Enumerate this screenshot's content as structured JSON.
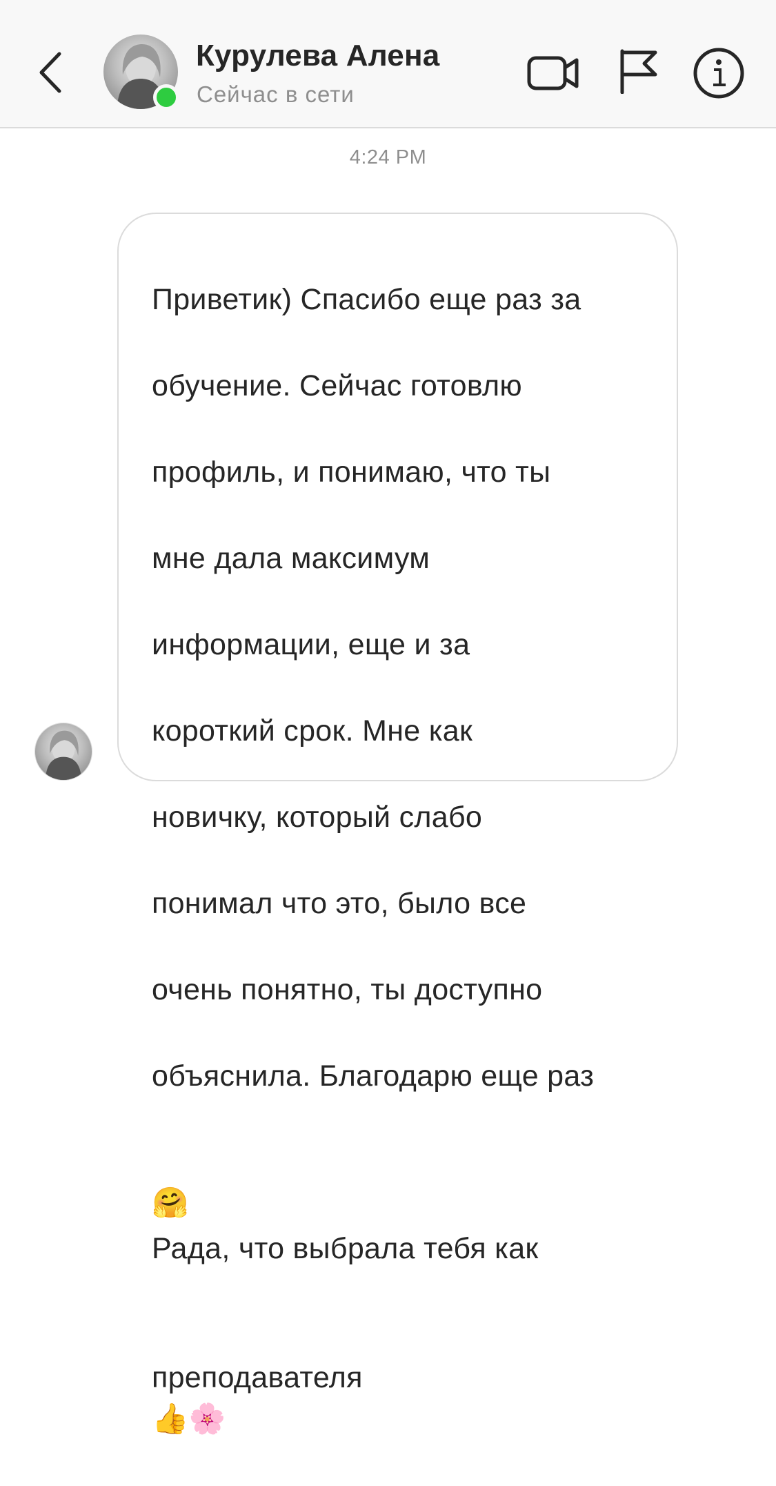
{
  "header": {
    "back_icon": "chevron-left-icon",
    "contact_name": "Курулева Алена",
    "status_text": "Сейчас в сети",
    "online_color": "#2ecc40",
    "actions": [
      {
        "icon": "video-camera-icon"
      },
      {
        "icon": "flag-icon"
      },
      {
        "icon": "info-icon"
      }
    ]
  },
  "thread": {
    "timestamp": "4:24 PM",
    "message": {
      "lines": [
        "Приветик) Спасибо еще раз за",
        "обучение. Сейчас готовлю",
        "профиль, и понимаю, что ты",
        "мне дала максимум",
        "информации, еще и за",
        "короткий срок. Мне как",
        "новичку, который слабо",
        "понимал что это, было все",
        "очень понятно, ты доступно",
        "объяснила. Благодарю еще раз"
      ],
      "line_11_emoji": "🤗",
      "line_11_text": "Рада, что выбрала тебя как",
      "line_12_text": "преподавателя",
      "line_12_emojis": "👍🌸"
    }
  }
}
